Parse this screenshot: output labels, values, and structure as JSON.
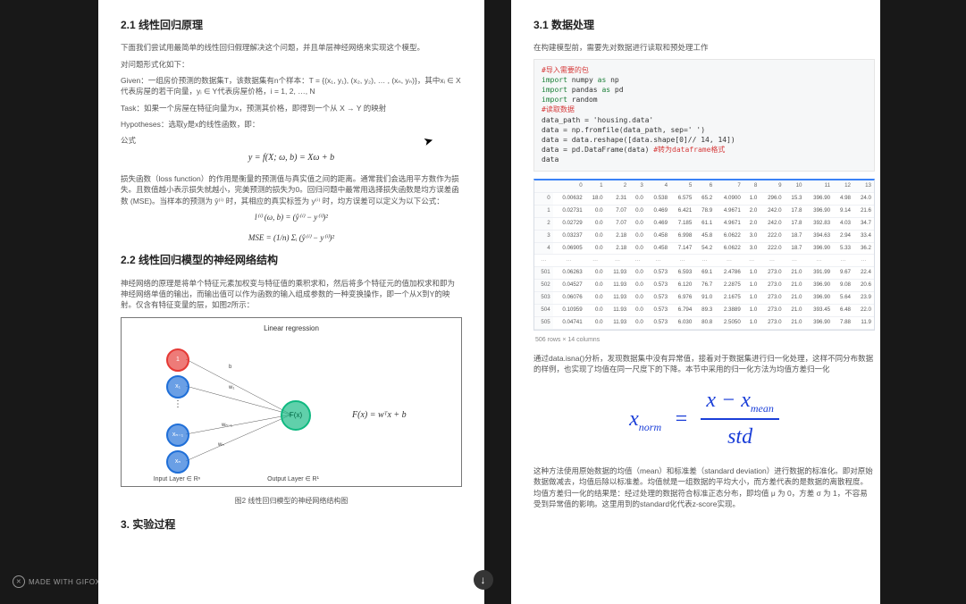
{
  "left": {
    "h2_1": "2.1 线性回归原理",
    "intro": "下面我们尝试用最简单的线性回归假理解决这个问题，并且单层神经网络来实现这个模型。",
    "formalize": "对问题形式化如下：",
    "given": "Given：一组房价预测的数据集T，该数据集有n个样本：T = {(x₁, y₁), (x₂, y₂), … , (xₙ, yₙ)}，其中xᵢ ∈ X代表房屋的若干向量，yᵢ ∈ Y代表房屋价格，i = 1, 2, …, N",
    "task": "Task：如果一个房屋在特征向量为x，预测其价格，即得到一个从 X → Y 的映射",
    "hypo": "Hypotheses：选取y是x的线性函数，即：",
    "formula_label": "公式",
    "formula_main": "y = f(X; ω, b) = Xω + b",
    "loss_para": "损失函数（loss function）的作用是衡量的预测值与真实值之间的距离。通常我们会选用平方数作为损失。且数值越小表示损失就越小，完美预测的损失为0。回归问题中最常用选择损失函数是均方误差函数 (MSE)。当样本的预测为 ŷ⁽ⁱ⁾ 时，其相应的真实标签为 y⁽ⁱ⁾ 时，均方误差可以定义为以下公式：",
    "mse_line1": "l⁽ⁱ⁾ (ω, b) = (ŷ⁽ⁱ⁾ − y⁽ⁱ⁾)²",
    "mse_line2": "MSE = (1/n) Σᵢ (ŷ⁽ⁱ⁾ − y⁽ⁱ⁾)²",
    "h2_2": "2.2 线性回归模型的神经网络结构",
    "nn_para": "神经网络的原理是将单个特征元素加权变与特征值的乘积求和，然后将多个特征元的值加权求和即为神经网络单值的输出，而输出值可以作为函数的输入组成参数的一种变换操作，即一个从X到Y的映射。仅含有特征变量的层，如图2所示：",
    "fig_title": "Linear regression",
    "fig_fx": "F(x) = wᵀx + b",
    "fig_nodes": {
      "one": "1",
      "x1": "x₁",
      "dots": "⋮",
      "xn1": "xₙ₋₁",
      "xn": "xₙ",
      "fx": "F(x)"
    },
    "fig_w": {
      "b": "b",
      "w1": "w₁",
      "wn1": "wₙ₋₁",
      "wn": "wₙ"
    },
    "fig_input": "Input Layer ∈ Rⁿ",
    "fig_output": "Output Layer ∈ R¹",
    "fig_caption": "图2  线性回归模型的神经网络结构图",
    "h3_3": "3. 实验过程"
  },
  "right": {
    "h2_1": "3.1 数据处理",
    "intro": "在构建模型前，需要先对数据进行读取和预处理工作",
    "code": {
      "c1": "#导入需要的包",
      "l1": "import numpy as np",
      "l2": "import pandas as pd",
      "l3": "import random",
      "c2": "#读取数据",
      "l4": "data_path = 'housing.data'",
      "l5": "data = np.fromfile(data_path, sep=' ')",
      "l6": "data = data.reshape([data.shape[0]// 14, 14])",
      "l7": "data = pd.DataFrame(data) ",
      "c3": "#转为dataframe格式",
      "l8": "data"
    },
    "chart_data": {
      "type": "table",
      "columns": [
        0,
        1,
        2,
        3,
        4,
        5,
        6,
        7,
        8,
        9,
        10,
        11,
        12,
        13
      ],
      "rows": [
        {
          "idx": "0",
          "v": [
            "0.00632",
            "18.0",
            "2.31",
            "0.0",
            "0.538",
            "6.575",
            "65.2",
            "4.0900",
            "1.0",
            "296.0",
            "15.3",
            "396.90",
            "4.98",
            "24.0"
          ]
        },
        {
          "idx": "1",
          "v": [
            "0.02731",
            "0.0",
            "7.07",
            "0.0",
            "0.469",
            "6.421",
            "78.9",
            "4.9671",
            "2.0",
            "242.0",
            "17.8",
            "396.90",
            "9.14",
            "21.6"
          ]
        },
        {
          "idx": "2",
          "v": [
            "0.02729",
            "0.0",
            "7.07",
            "0.0",
            "0.469",
            "7.185",
            "61.1",
            "4.9671",
            "2.0",
            "242.0",
            "17.8",
            "392.83",
            "4.03",
            "34.7"
          ]
        },
        {
          "idx": "3",
          "v": [
            "0.03237",
            "0.0",
            "2.18",
            "0.0",
            "0.458",
            "6.998",
            "45.8",
            "6.0622",
            "3.0",
            "222.0",
            "18.7",
            "394.63",
            "2.94",
            "33.4"
          ]
        },
        {
          "idx": "4",
          "v": [
            "0.06905",
            "0.0",
            "2.18",
            "0.0",
            "0.458",
            "7.147",
            "54.2",
            "6.0622",
            "3.0",
            "222.0",
            "18.7",
            "396.90",
            "5.33",
            "36.2"
          ]
        },
        {
          "idx": "501",
          "v": [
            "0.06263",
            "0.0",
            "11.93",
            "0.0",
            "0.573",
            "6.593",
            "69.1",
            "2.4786",
            "1.0",
            "273.0",
            "21.0",
            "391.99",
            "9.67",
            "22.4"
          ]
        },
        {
          "idx": "502",
          "v": [
            "0.04527",
            "0.0",
            "11.93",
            "0.0",
            "0.573",
            "6.120",
            "76.7",
            "2.2875",
            "1.0",
            "273.0",
            "21.0",
            "396.90",
            "9.08",
            "20.6"
          ]
        },
        {
          "idx": "503",
          "v": [
            "0.06076",
            "0.0",
            "11.93",
            "0.0",
            "0.573",
            "6.976",
            "91.0",
            "2.1675",
            "1.0",
            "273.0",
            "21.0",
            "396.90",
            "5.64",
            "23.9"
          ]
        },
        {
          "idx": "504",
          "v": [
            "0.10959",
            "0.0",
            "11.93",
            "0.0",
            "0.573",
            "6.794",
            "89.3",
            "2.3889",
            "1.0",
            "273.0",
            "21.0",
            "393.45",
            "6.48",
            "22.0"
          ]
        },
        {
          "idx": "505",
          "v": [
            "0.04741",
            "0.0",
            "11.93",
            "0.0",
            "0.573",
            "6.030",
            "80.8",
            "2.5050",
            "1.0",
            "273.0",
            "21.0",
            "396.90",
            "7.88",
            "11.9"
          ]
        }
      ],
      "footer": "506 rows × 14 columns"
    },
    "para2": "通过data.isna()分析，发现数据集中没有异常值，接着对于数据集进行归一化处理，这样不同分布数据的样例，也实现了均值在同一尺度下的下降。本节中采用的归一化方法为均值方差归一化",
    "formula": {
      "lhs": "x",
      "lhs_sub": "norm",
      "eq": "=",
      "num_l": "x − x",
      "num_sub": "mean",
      "den": "std"
    },
    "para3": "这种方法使用原始数据的均值（mean）和标准差（standard deviation）进行数据的标准化。即对原始数据做减去，均值后除以标准差。均值就是一组数据的平均大小，而方差代表的是数据的离散程度。均值方差归一化的结果是：经过处理的数据符合标准正态分布，即均值 μ 为 0，方差 σ 为 1，不容易受到异常值的影响。这里用到的standard化代表z-score实现。"
  },
  "ui": {
    "gifox": "MADE WITH GIFOX",
    "scroll_arrow": "↓"
  }
}
